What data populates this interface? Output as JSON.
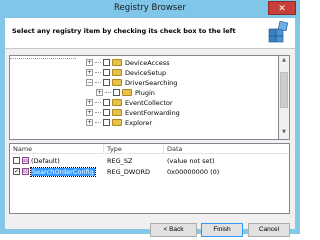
{
  "window": {
    "title": "Registry Browser",
    "close_label": "✕"
  },
  "header": {
    "instruction": "Select any registry item by checking its check box to the left"
  },
  "tree": {
    "items": [
      {
        "label": "DeviceAccess",
        "expander": "+"
      },
      {
        "label": "DeviceSetup",
        "expander": "+"
      },
      {
        "label": "DriverSearching",
        "expander": "−"
      },
      {
        "label": "Plugin",
        "expander": "+"
      },
      {
        "label": "EventCollector",
        "expander": "+"
      },
      {
        "label": "EventForwarding",
        "expander": "+"
      },
      {
        "label": "Explorer",
        "expander": "+"
      }
    ]
  },
  "list": {
    "columns": {
      "name": "Name",
      "type": "Type",
      "data": "Data"
    },
    "rows": [
      {
        "name": "(Default)",
        "type": "REG_SZ",
        "data": "(value not set)",
        "checked": false,
        "icon": "ab"
      },
      {
        "name": "SearchOrderConfig",
        "type": "REG_DWORD",
        "data": "0x00000000 (0)",
        "checked": true,
        "icon": "01"
      }
    ]
  },
  "buttons": {
    "back": "< Back",
    "finish": "Finish",
    "cancel": "Cancel"
  },
  "colors": {
    "titlebar": "#80c6e8",
    "selection": "#3399ff",
    "close": "#c6403a"
  }
}
